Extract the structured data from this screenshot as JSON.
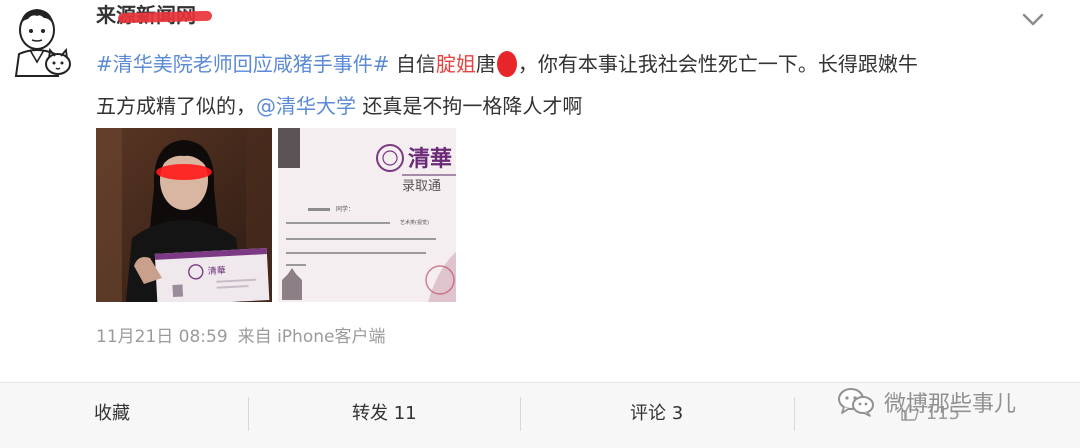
{
  "post": {
    "username": "来源新闻网",
    "text_line1": {
      "topic": "#清华美院老师回应咸猪手事件#",
      "part1": " 自信",
      "highlight": "腚姐",
      "part2": "唐",
      "part3": "，你有本事让我社会性死亡一下。长得跟嫩牛"
    },
    "text_line2": {
      "part1": "五方成精了似的，",
      "mention": "@清华大学",
      "part2": " 还真是不拘一格降人才啊"
    },
    "timestamp": "11月21日 08:59",
    "source": "来自 iPhone客户端"
  },
  "actions": {
    "favorite": "收藏",
    "repost": "转发 11",
    "comment": "评论 3",
    "like_count": "115"
  },
  "watermark": {
    "text": "微博那些事儿"
  },
  "photos": {
    "letter_school": "清華",
    "letter_title": "录取通",
    "letter_greeting": "同学：",
    "letter_major": "艺术类(视觉)"
  },
  "icons": {
    "avatar": "cartoon-avatar-icon",
    "chevron": "chevron-down-icon",
    "like": "thumbs-up-icon",
    "watermark": "wechat-icon"
  },
  "colors": {
    "link": "#5b8ad6",
    "highlight": "#e64340",
    "redaction": "#e8262a",
    "meta": "#9b9b9b",
    "action_bar": "#f7f7f7"
  }
}
